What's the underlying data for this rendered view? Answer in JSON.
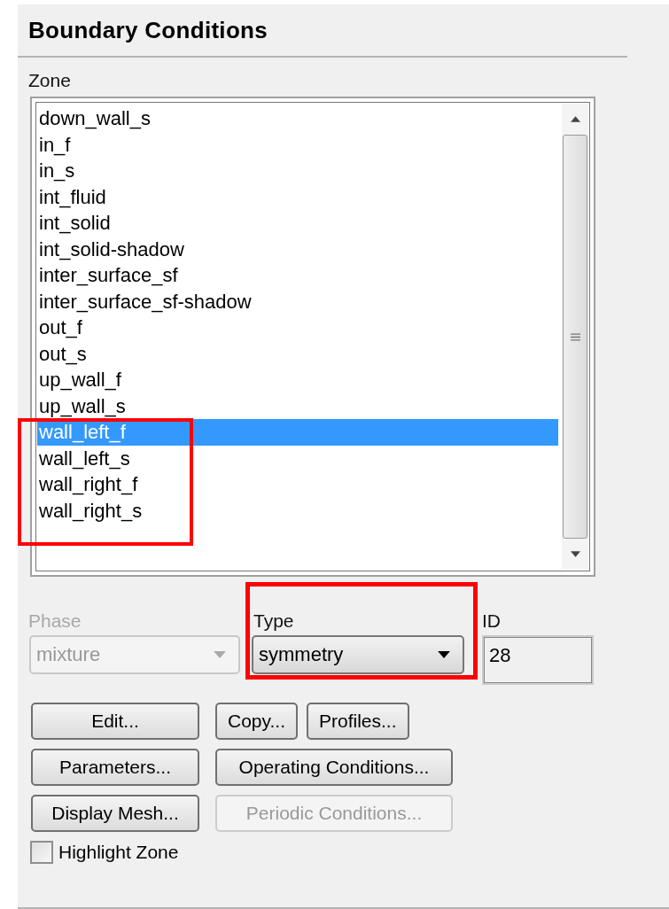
{
  "panel": {
    "title": "Boundary Conditions"
  },
  "zone": {
    "label": "Zone",
    "items": [
      {
        "label": "down_wall_s",
        "selected": false
      },
      {
        "label": "in_f",
        "selected": false
      },
      {
        "label": "in_s",
        "selected": false
      },
      {
        "label": "int_fluid",
        "selected": false
      },
      {
        "label": "int_solid",
        "selected": false
      },
      {
        "label": "int_solid-shadow",
        "selected": false
      },
      {
        "label": "inter_surface_sf",
        "selected": false
      },
      {
        "label": "inter_surface_sf-shadow",
        "selected": false
      },
      {
        "label": "out_f",
        "selected": false
      },
      {
        "label": "out_s",
        "selected": false
      },
      {
        "label": "up_wall_f",
        "selected": false
      },
      {
        "label": "up_wall_s",
        "selected": false
      },
      {
        "label": "wall_left_f",
        "selected": true
      },
      {
        "label": "wall_left_s",
        "selected": false
      },
      {
        "label": "wall_right_f",
        "selected": false
      },
      {
        "label": "wall_right_s",
        "selected": false
      }
    ]
  },
  "phase": {
    "label": "Phase",
    "value": "mixture",
    "disabled": true
  },
  "type": {
    "label": "Type",
    "value": "symmetry",
    "disabled": false
  },
  "id": {
    "label": "ID",
    "value": "28"
  },
  "buttons": [
    [
      {
        "label": "Edit...",
        "disabled": false,
        "wide": false
      },
      {
        "label": "Copy...",
        "disabled": false,
        "wide": false
      },
      {
        "label": "Profiles...",
        "disabled": false,
        "wide": false
      }
    ],
    [
      {
        "label": "Parameters...",
        "disabled": false,
        "wide": false
      },
      {
        "label": "Operating Conditions...",
        "disabled": false,
        "wide": true
      }
    ],
    [
      {
        "label": "Display Mesh...",
        "disabled": false,
        "wide": false
      },
      {
        "label": "Periodic Conditions...",
        "disabled": true,
        "wide": true
      }
    ]
  ],
  "highlight_zone": {
    "label": "Highlight Zone",
    "checked": false
  }
}
